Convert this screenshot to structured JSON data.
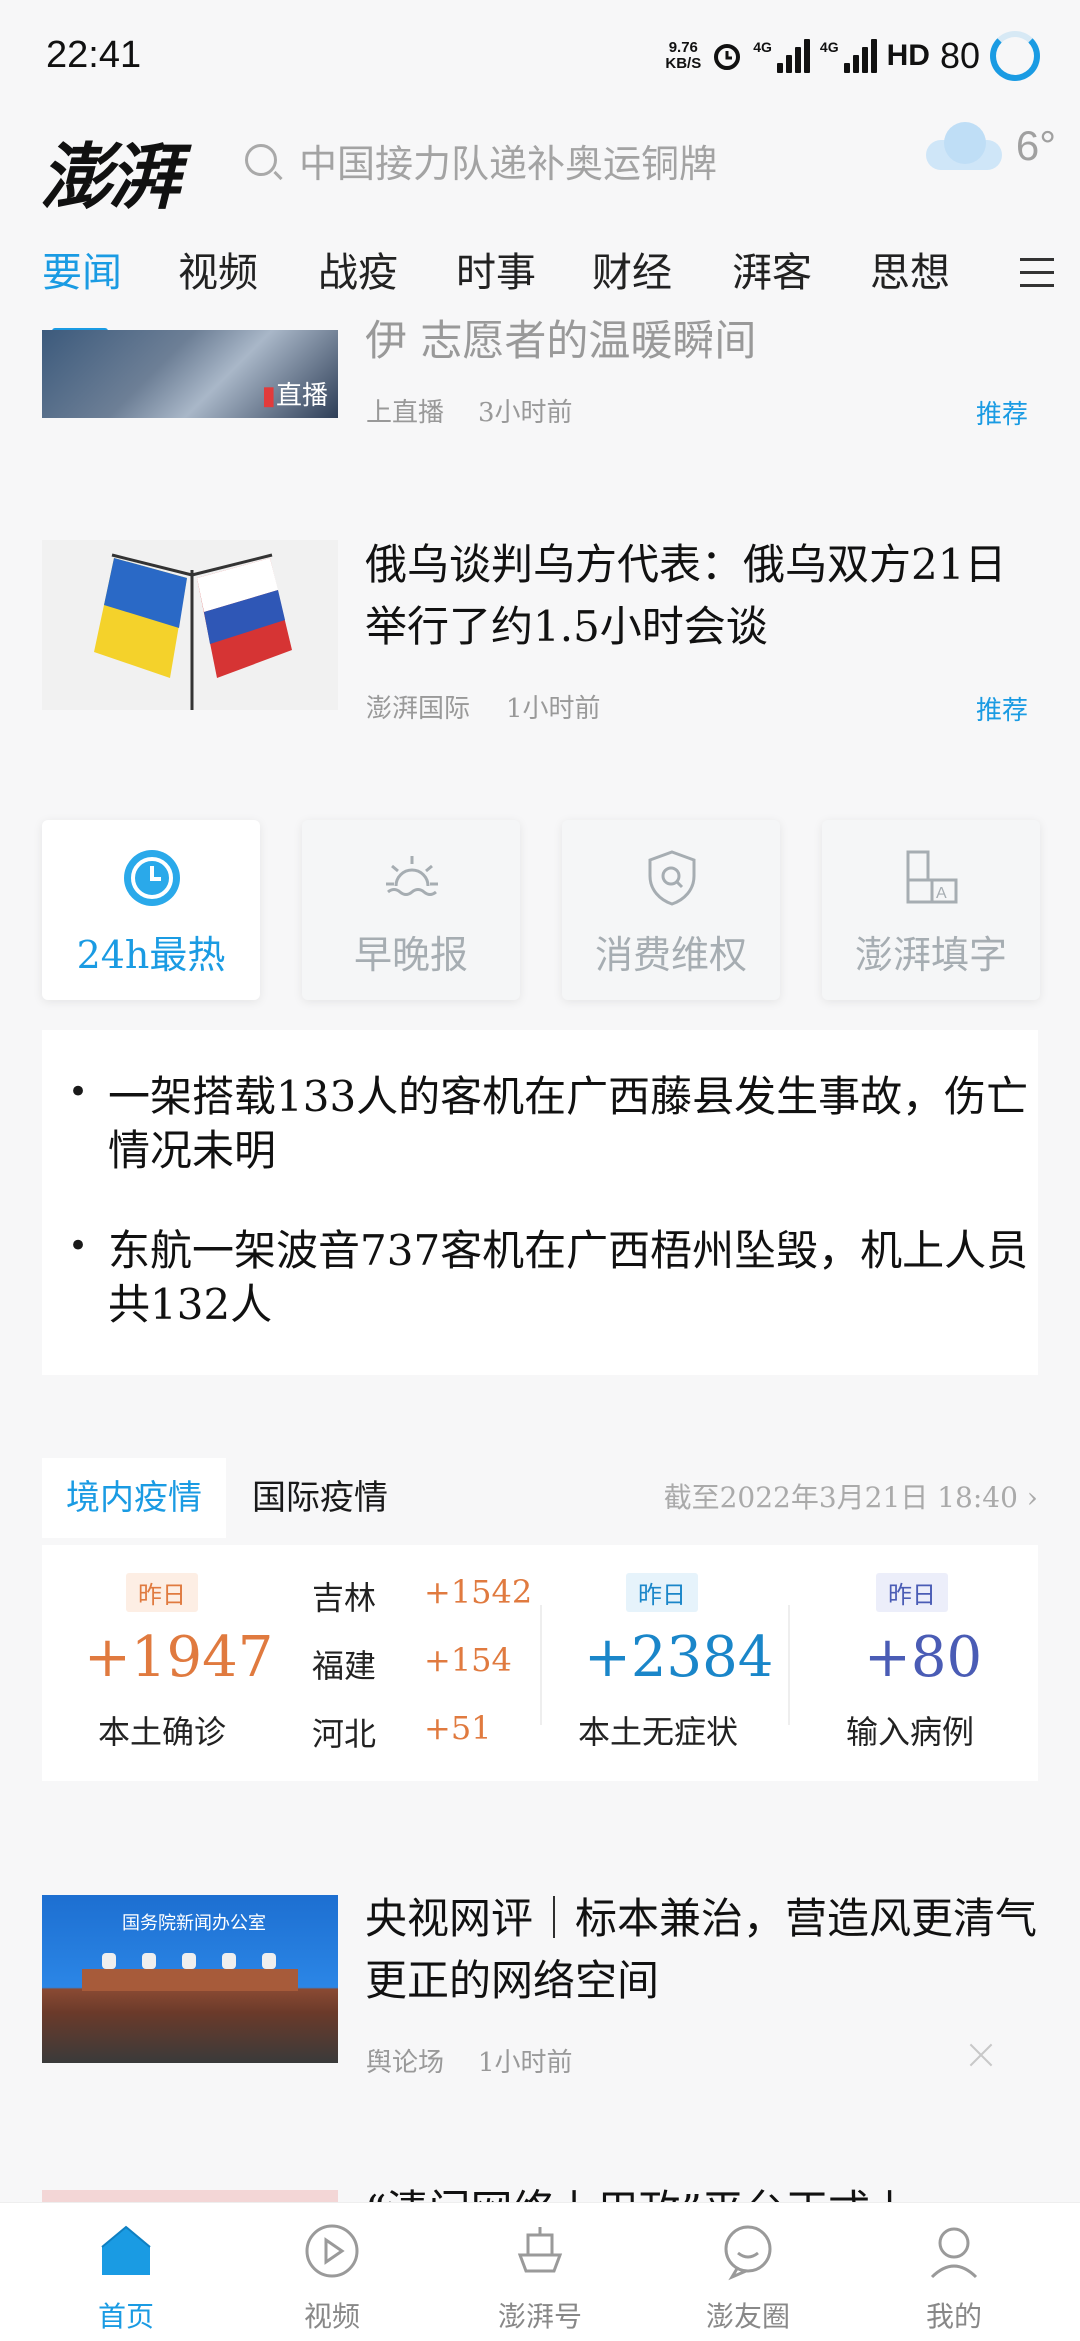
{
  "status_bar": {
    "time": "22:41",
    "net_speed_value": "9.76",
    "net_speed_unit": "KB/S",
    "signal1": "4G",
    "signal2": "4G",
    "hd": "HD",
    "battery": "80"
  },
  "header": {
    "logo": "澎湃",
    "search_placeholder": "中国接力队递补奥运铜牌",
    "weather_icon": "cloud-icon",
    "temperature": "6°"
  },
  "tabs": [
    "要闻",
    "视频",
    "战疫",
    "时事",
    "财经",
    "湃客",
    "思想"
  ],
  "active_tab": "要闻",
  "news_top": {
    "title_partial": "伊   志愿者的温暖瞬间",
    "badge": "直播",
    "source": "上直播",
    "time": "3小时前",
    "tag": "推荐"
  },
  "news_1": {
    "title": "俄乌谈判乌方代表：俄乌双方21日举行了约1.5小时会谈",
    "source": "澎湃国际",
    "time": "1小时前",
    "tag": "推荐"
  },
  "feature_cards": [
    {
      "label": "24h最热",
      "icon": "clock-icon"
    },
    {
      "label": "早晚报",
      "icon": "sunrise-icon"
    },
    {
      "label": "消费维权",
      "icon": "shield-icon"
    },
    {
      "label": "澎湃填字",
      "icon": "crossword-icon"
    }
  ],
  "headlines": [
    "一架搭载133人的客机在广西藤县发生事故，伤亡情况未明",
    "东航一架波音737客机在广西梧州坠毁，机上人员共132人"
  ],
  "covid": {
    "tab_domestic": "境内疫情",
    "tab_international": "国际疫情",
    "date_label": "截至2022年3月21日 18:40",
    "badge": "昨日",
    "confirmed": {
      "value": "+1947",
      "label": "本土确诊"
    },
    "provinces": [
      {
        "name": "吉林",
        "value": "+1542"
      },
      {
        "name": "福建",
        "value": "+154"
      },
      {
        "name": "河北",
        "value": "+51"
      }
    ],
    "asymptomatic": {
      "value": "+2384",
      "label": "本土无症状"
    },
    "imported": {
      "value": "+80",
      "label": "输入病例"
    },
    "colors": {
      "confirmed": "#e07a3f",
      "asymptomatic": "#1a86c9",
      "imported": "#4a5cb5"
    }
  },
  "news_2": {
    "title": "央视网评｜标本兼治，营造风更清气更正的网络空间",
    "source": "舆论场",
    "time": "1小时前",
    "image_caption": "国务院新闻办公室"
  },
  "news_3": {
    "title_partial": "“清门网络上用政”平台正式上"
  },
  "bottom_nav": [
    {
      "label": "首页",
      "icon": "home-icon"
    },
    {
      "label": "视频",
      "icon": "play-icon"
    },
    {
      "label": "澎湃号",
      "icon": "ship-icon"
    },
    {
      "label": "澎友圈",
      "icon": "chat-icon"
    },
    {
      "label": "我的",
      "icon": "user-icon"
    }
  ],
  "accent_color": "#1a9be3"
}
